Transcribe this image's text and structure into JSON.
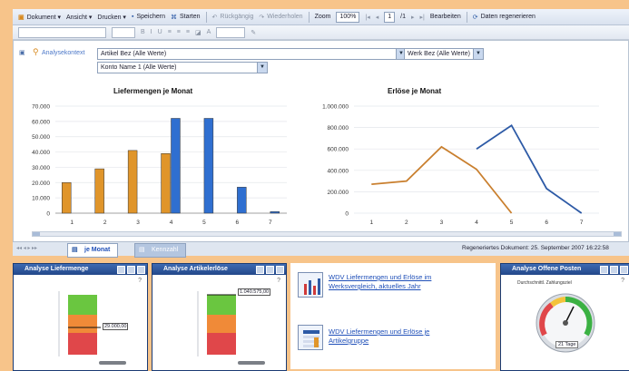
{
  "toolbar": {
    "dokument": "Dokument ▾",
    "ansicht": "Ansicht ▾",
    "drucken": "Drucken ▾",
    "speichern": "Speichern",
    "starten": "Starten",
    "rueckgaengig": "Rückgängig",
    "wiederholen": "Wiederholen",
    "zoom_label": "Zoom",
    "zoom_value": "100%",
    "page_value": "1",
    "page_total": "/1",
    "bearbeiten": "Bearbeiten",
    "daten_neu": "Daten regenerieren"
  },
  "filters": {
    "analysekontext": "Analysekontext",
    "artikel": "Artikel Bez (Alle Werte)",
    "werk": "Werk Bez (Alle Werte)",
    "konto": "Konto Name 1 (Alle Werte)"
  },
  "chart_data": [
    {
      "type": "bar",
      "title": "Liefermengen je Monat",
      "categories": [
        "1",
        "2",
        "3",
        "4",
        "5",
        "6",
        "7"
      ],
      "series": [
        {
          "values": [
            20000,
            29000,
            41000,
            39000,
            0,
            0,
            0
          ],
          "color": "#e0952a"
        },
        {
          "values": [
            0,
            0,
            0,
            62000,
            62000,
            17000,
            1000
          ],
          "color": "#2f6fd0"
        }
      ],
      "ylim": [
        0,
        70000
      ],
      "yticks": [
        "70.000",
        "60.000",
        "50.000",
        "40.000",
        "30.000",
        "20.000",
        "10.000",
        "0"
      ]
    },
    {
      "type": "line",
      "title": "Erlöse je Monat",
      "categories": [
        "1",
        "2",
        "3",
        "4",
        "5",
        "6",
        "7"
      ],
      "series": [
        {
          "values": [
            270000,
            300000,
            620000,
            410000,
            0,
            null,
            null
          ],
          "color": "#c97f2e"
        },
        {
          "values": [
            null,
            null,
            null,
            600000,
            820000,
            230000,
            0
          ],
          "color": "#2d5aa6"
        }
      ],
      "ylim": [
        0,
        1000000
      ],
      "yticks": [
        "1.000.000",
        "800.000",
        "600.000",
        "400.000",
        "200.000",
        "0"
      ]
    }
  ],
  "tabs": {
    "active": "je Monat",
    "inactive": "Kennzahl"
  },
  "status": "Regeneriertes Dokument: 25. September 2007 16:22:58",
  "panels": {
    "liefermenge": {
      "title": "Analyse Liefermenge",
      "value": "29.000,00"
    },
    "artikelerloese": {
      "title": "Analyse Artikelerlöse",
      "value": "1.040.575,00"
    },
    "offene": {
      "title": "Analyse Offene Posten",
      "gauge_title": "Durchschnittl. Zahlungsziel",
      "value": "21 Tage"
    }
  },
  "links": {
    "link1_line1": "WDV Liefermengen und Erlöse im",
    "link1_line2": "Werksvergleich, aktuelles Jahr",
    "link2_line1": "WDV Liefermengen und Erlöse je",
    "link2_line2": "Artikelgruppe"
  }
}
